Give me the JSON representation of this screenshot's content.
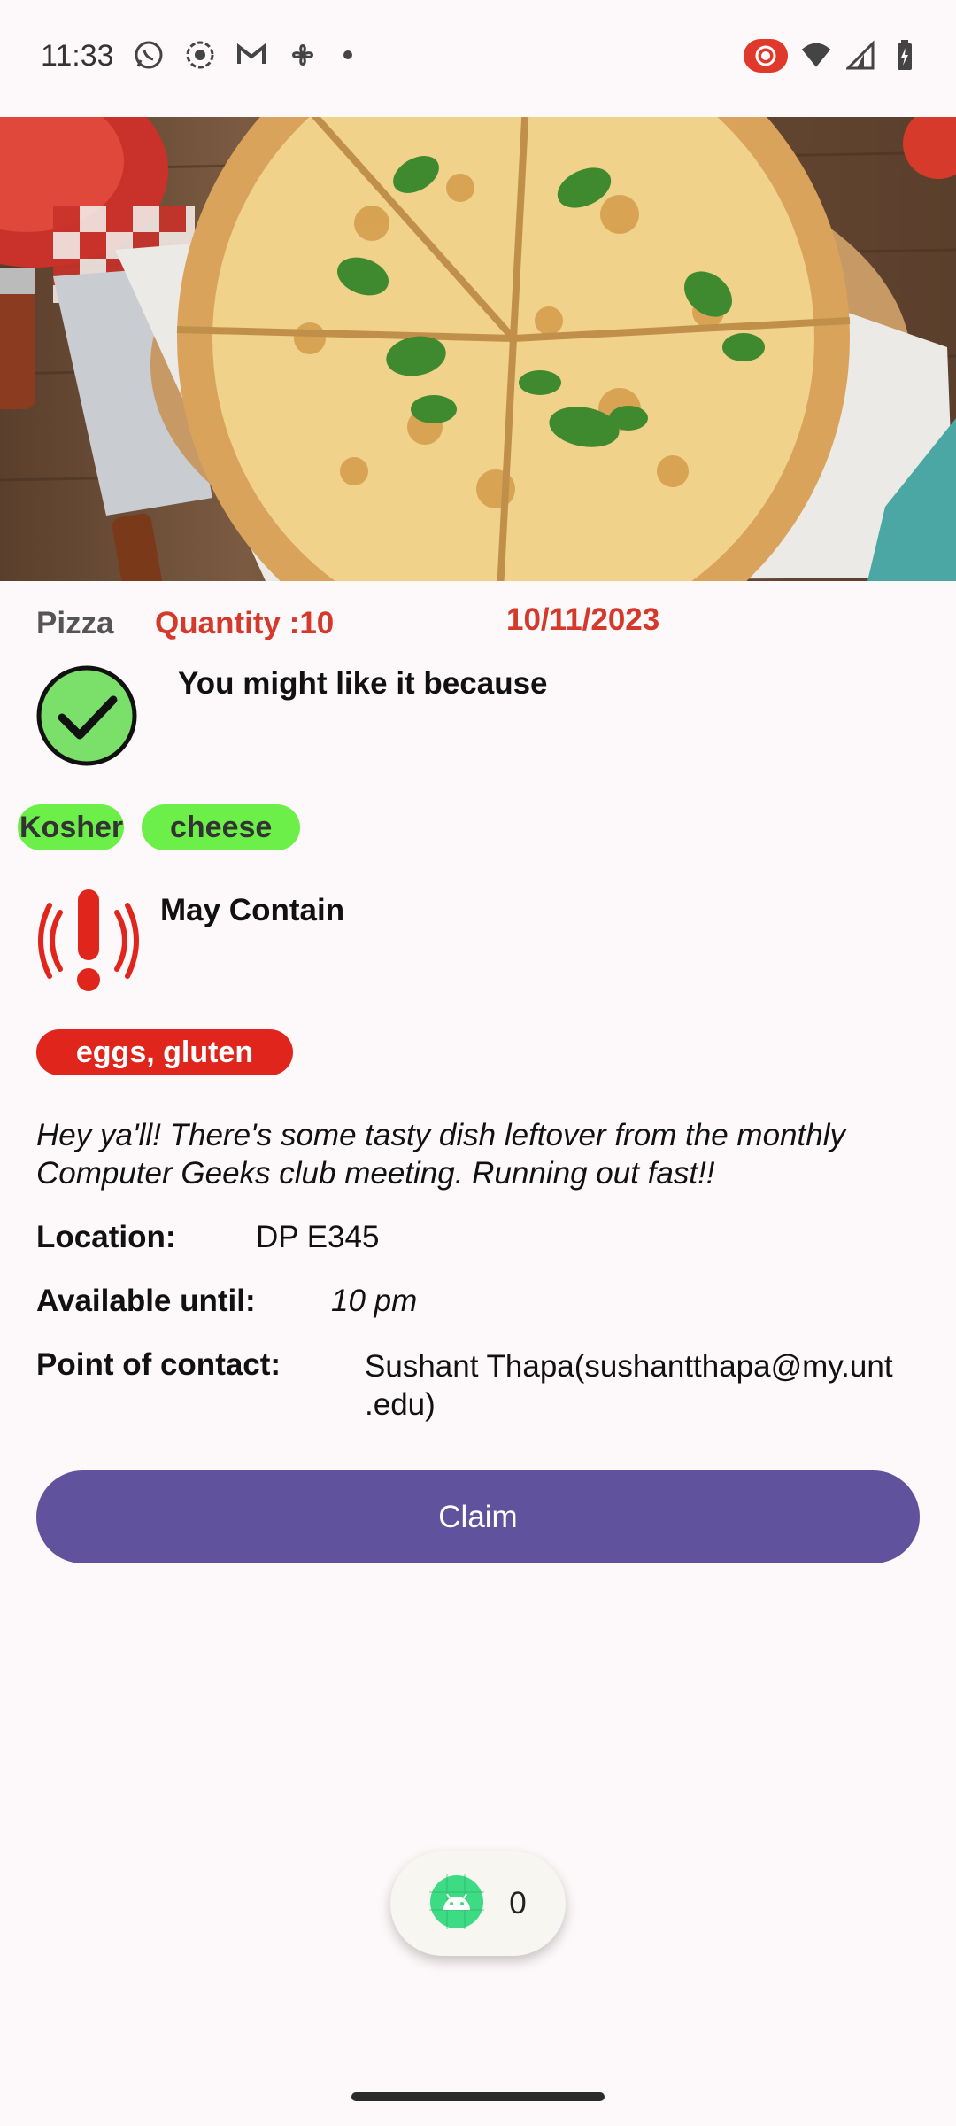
{
  "status_bar": {
    "time": "11:33",
    "left_icons": [
      "whatsapp-icon",
      "screen-record-icon",
      "gmail-icon",
      "fan-icon",
      "dot-icon"
    ],
    "right_icons": [
      "recording-indicator-icon",
      "wifi-icon",
      "signal-icon",
      "battery-charging-icon"
    ]
  },
  "hero": {
    "image": "pizza-photo"
  },
  "food": {
    "name": "Pizza",
    "quantity": "Quantity :10",
    "date": "10/11/2023"
  },
  "recommendation": {
    "label": "You might like it because",
    "tags": [
      "Kosher",
      "cheese"
    ]
  },
  "warning": {
    "label": "May Contain",
    "allergens": "eggs, gluten"
  },
  "description": "Hey ya'll! There's some tasty dish leftover from the monthly Computer Geeks club meeting. Running out fast!!",
  "details": {
    "location_label": "Location:",
    "location_value": "DP E345",
    "available_label": "Available until:",
    "available_value": "10 pm",
    "contact_label": "Point of contact:",
    "contact_value_line1": "Sushant Thapa(sushantthapa@my.unt",
    "contact_value_line2": ".edu)"
  },
  "claim_label": "Claim",
  "fab": {
    "count": "0"
  },
  "colors": {
    "accent_red": "#d33a2c",
    "tag_green": "#6cf049",
    "allergen_red": "#e0261c",
    "button_purple": "#61529d"
  }
}
